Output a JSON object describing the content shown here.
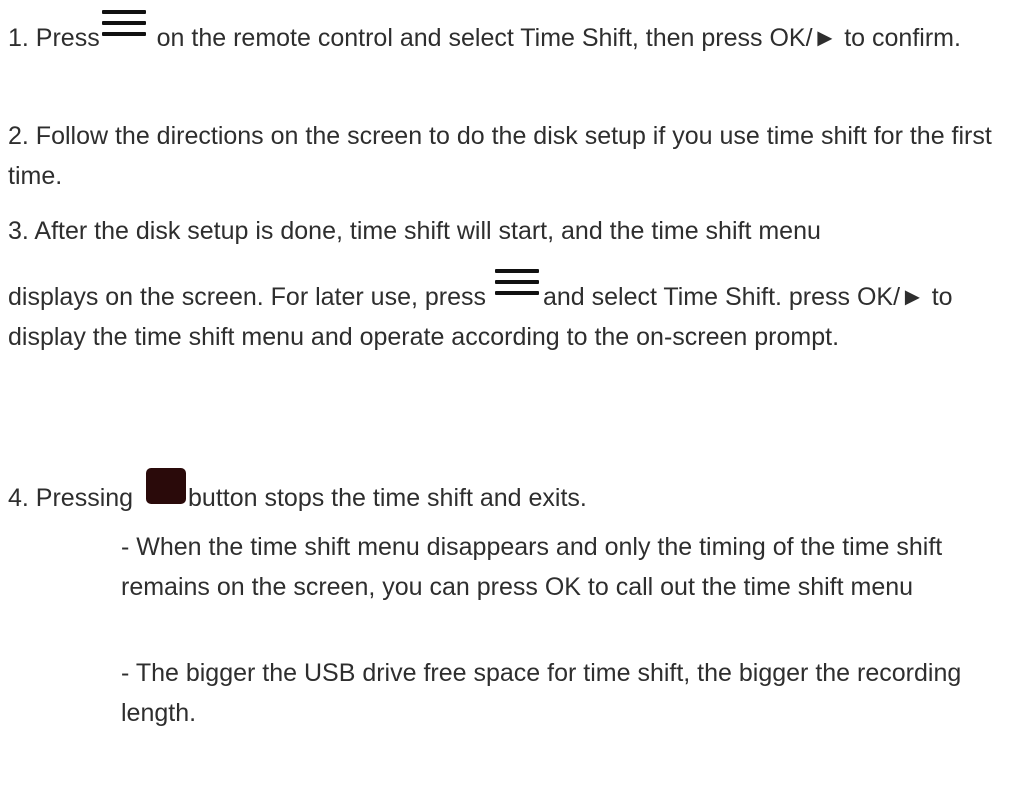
{
  "step1": {
    "lead": "1. Press",
    "rest": " on the remote control and select Time Shift, then press OK/► to confirm."
  },
  "step2": {
    "text": "2. Follow the directions on the screen to do the disk setup if you use time shift for the first time."
  },
  "step3": {
    "line1": "3. After the disk setup is done, time shift will start, and the time shift menu",
    "lead": "displays on the screen. For later use, press ",
    "rest": "and select Time Shift. press OK/► to display the time shift menu and operate according to the on-screen prompt."
  },
  "step4": {
    "lead": "4. Pressing ",
    "rest": "button stops the time shift and exits."
  },
  "notes": [
    "- When the time shift menu disappears and only the timing of the time shift remains on the screen, you can press OK to call out the time shift menu",
    "- The bigger the USB drive free space for time shift, the bigger the recording length."
  ],
  "icons": {
    "menu": "menu-icon",
    "stop": "stop-icon"
  },
  "colors": {
    "text": "#2e2e2e",
    "menu_icon": "#111111",
    "stop_icon": "#2a0a0a"
  }
}
